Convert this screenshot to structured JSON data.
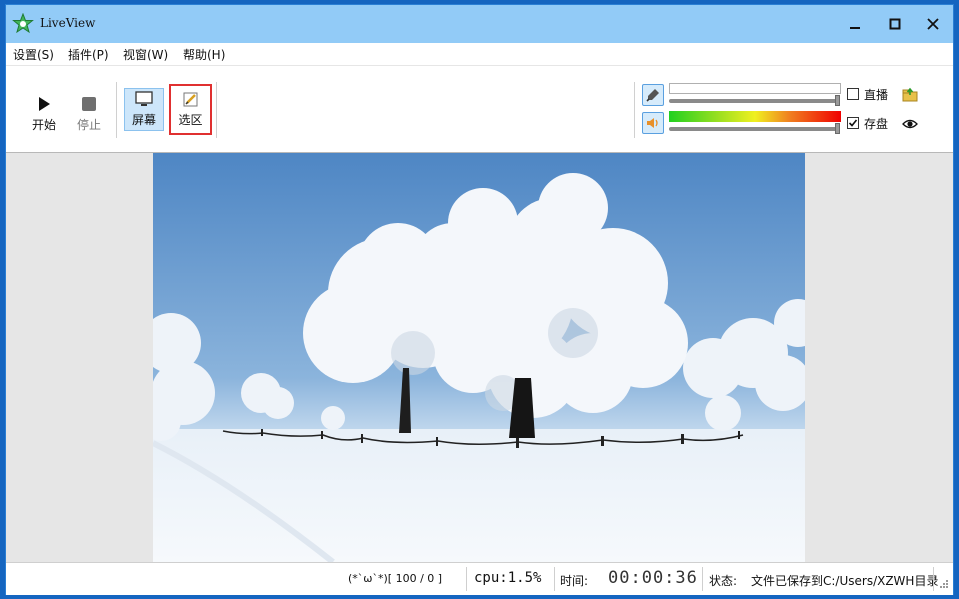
{
  "window": {
    "title": "LiveView",
    "minimize_glyph": "—",
    "maximize_glyph": "☐",
    "close_glyph": "✕"
  },
  "menu": [
    "设置(S)",
    "插件(P)",
    "视窗(W)",
    "帮助(H)"
  ],
  "toolbar": {
    "start_label": "开始",
    "stop_label": "停止",
    "screen_label": "屏幕",
    "region_label": "选区",
    "live_label": "直播",
    "live_checked": false,
    "save_label": "存盘",
    "save_checked": true,
    "mic_icon": "microphone-icon",
    "speaker_icon": "speaker-icon"
  },
  "status": {
    "face": "(*`ω`*)[ 100 / 0 ]",
    "cpu": "cpu:1.5%",
    "time_label": "时间:",
    "time_value": "00:00:36",
    "state_label": "状态:",
    "state_value": "文件已保存到C:/Users/XZWH目录"
  },
  "colors": {
    "titlebar": "#92cbf7",
    "accent": "#2a7fd4",
    "selection_box": "#e03030"
  }
}
